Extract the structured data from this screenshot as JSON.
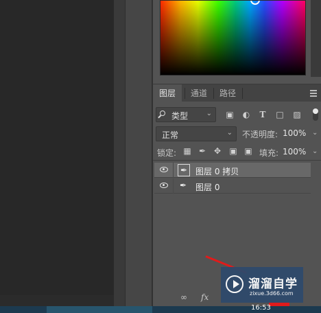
{
  "color_picker": {
    "marker_color": "#ffffff"
  },
  "tabs": [
    {
      "label": "图层",
      "active": true
    },
    {
      "label": "通道",
      "active": false
    },
    {
      "label": "路径",
      "active": false
    }
  ],
  "filter": {
    "kind_label": "类型",
    "icons": [
      "image-filter-icon",
      "adjustment-filter-icon",
      "type-filter-icon",
      "shape-filter-icon",
      "smart-object-filter-icon",
      "filter-toggle"
    ]
  },
  "blend": {
    "mode": "正常",
    "opacity_label": "不透明度:",
    "opacity_value": "100%"
  },
  "lock": {
    "label": "锁定:",
    "icons": [
      "lock-transparent-icon",
      "lock-paint-icon",
      "lock-position-icon",
      "lock-artboard-icon",
      "lock-all-icon"
    ],
    "fill_label": "填充:",
    "fill_value": "100%"
  },
  "layers": [
    {
      "name": "图层 0 拷贝",
      "visible": true,
      "selected": true
    },
    {
      "name": "图层 0",
      "visible": true,
      "selected": false
    }
  ],
  "bottom_icons": [
    "link-icon",
    "fx-icon"
  ],
  "bottom_labels": {
    "fx": "fx"
  },
  "watermark": {
    "title": "溜溜自学",
    "subtitle": "zixue.3d66.com"
  },
  "taskbar": {
    "time": "16:53"
  }
}
